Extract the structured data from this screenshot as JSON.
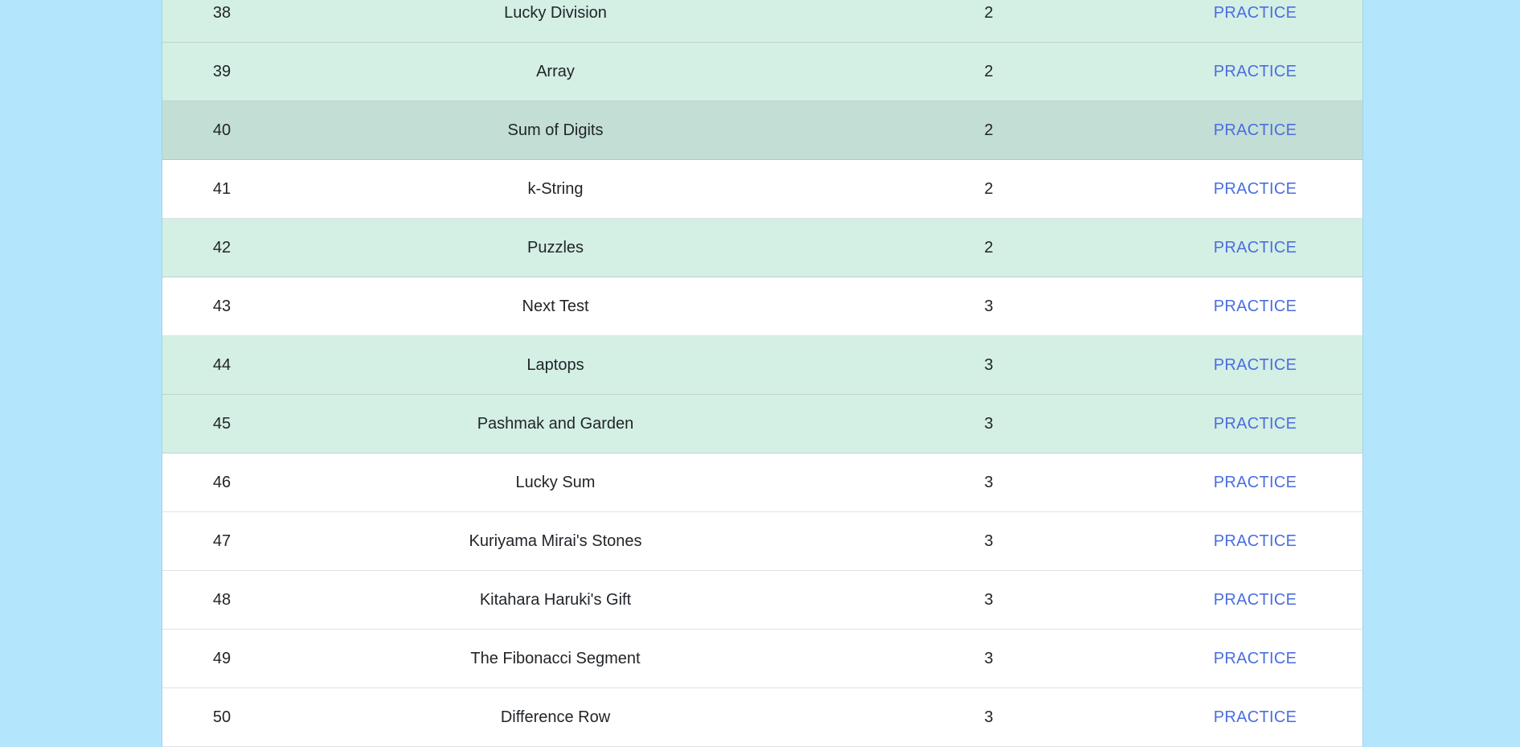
{
  "colors": {
    "page_background": "#b3e5fc",
    "row_green": "#d4efe4",
    "row_green_hover": "#c3ded5",
    "row_white": "#ffffff",
    "link": "#4a6ee0"
  },
  "problems": [
    {
      "num": "38",
      "name": "Lucky Division",
      "rating": "2",
      "action": "PRACTICE",
      "style": "green"
    },
    {
      "num": "39",
      "name": "Array",
      "rating": "2",
      "action": "PRACTICE",
      "style": "green"
    },
    {
      "num": "40",
      "name": "Sum of Digits",
      "rating": "2",
      "action": "PRACTICE",
      "style": "green-dark"
    },
    {
      "num": "41",
      "name": "k-String",
      "rating": "2",
      "action": "PRACTICE",
      "style": "white"
    },
    {
      "num": "42",
      "name": "Puzzles",
      "rating": "2",
      "action": "PRACTICE",
      "style": "green"
    },
    {
      "num": "43",
      "name": "Next Test",
      "rating": "3",
      "action": "PRACTICE",
      "style": "white"
    },
    {
      "num": "44",
      "name": "Laptops",
      "rating": "3",
      "action": "PRACTICE",
      "style": "green"
    },
    {
      "num": "45",
      "name": "Pashmak and Garden",
      "rating": "3",
      "action": "PRACTICE",
      "style": "green"
    },
    {
      "num": "46",
      "name": "Lucky Sum",
      "rating": "3",
      "action": "PRACTICE",
      "style": "white"
    },
    {
      "num": "47",
      "name": "Kuriyama Mirai's Stones",
      "rating": "3",
      "action": "PRACTICE",
      "style": "white"
    },
    {
      "num": "48",
      "name": "Kitahara Haruki's Gift",
      "rating": "3",
      "action": "PRACTICE",
      "style": "white"
    },
    {
      "num": "49",
      "name": "The Fibonacci Segment",
      "rating": "3",
      "action": "PRACTICE",
      "style": "white"
    },
    {
      "num": "50",
      "name": "Difference Row",
      "rating": "3",
      "action": "PRACTICE",
      "style": "white"
    }
  ]
}
